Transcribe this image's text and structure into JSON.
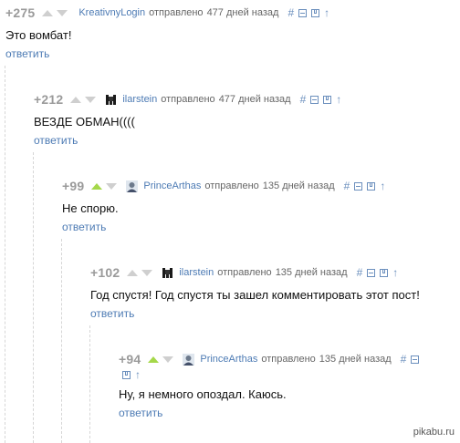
{
  "comments": [
    {
      "rating": "+275",
      "author": "KreativnyLogin",
      "sent_label": "отправлено",
      "time": "477 дней назад",
      "text": "Это вомбат!",
      "reply_label": "ответить",
      "vote_state": "none",
      "avatar": "none"
    },
    {
      "rating": "+212",
      "author": "ilarstein",
      "sent_label": "отправлено",
      "time": "477 дней назад",
      "text": "ВЕЗДЕ ОБМАН((((",
      "reply_label": "ответить",
      "vote_state": "none",
      "avatar": "dark-figure"
    },
    {
      "rating": "+99",
      "author": "PrinceArthas",
      "sent_label": "отправлено",
      "time": "135 дней назад",
      "text": "Не спорю.",
      "reply_label": "ответить",
      "vote_state": "up",
      "avatar": "portrait"
    },
    {
      "rating": "+102",
      "author": "ilarstein",
      "sent_label": "отправлено",
      "time": "135 дней назад",
      "text": "Год спустя! Год спустя ты зашел комментировать этот пост!",
      "reply_label": "ответить",
      "vote_state": "none",
      "avatar": "dark-figure"
    },
    {
      "rating": "+94",
      "author": "PrinceArthas",
      "sent_label": "отправлено",
      "time": "135 дней назад",
      "text": "Ну, я немного опоздал. Каюсь.",
      "reply_label": "ответить",
      "vote_state": "up",
      "avatar": "portrait"
    }
  ],
  "icons": {
    "link": "#",
    "arrow": "↑",
    "names": [
      "link-icon",
      "collapse-icon",
      "save-icon",
      "parent-arrow-icon"
    ]
  },
  "colors": {
    "link": "#4d7bb4",
    "rating": "#9a9a9a",
    "upvote_active": "#a5d84a",
    "vote_inactive": "#cfcfcf"
  },
  "watermark": "pikabu.ru"
}
